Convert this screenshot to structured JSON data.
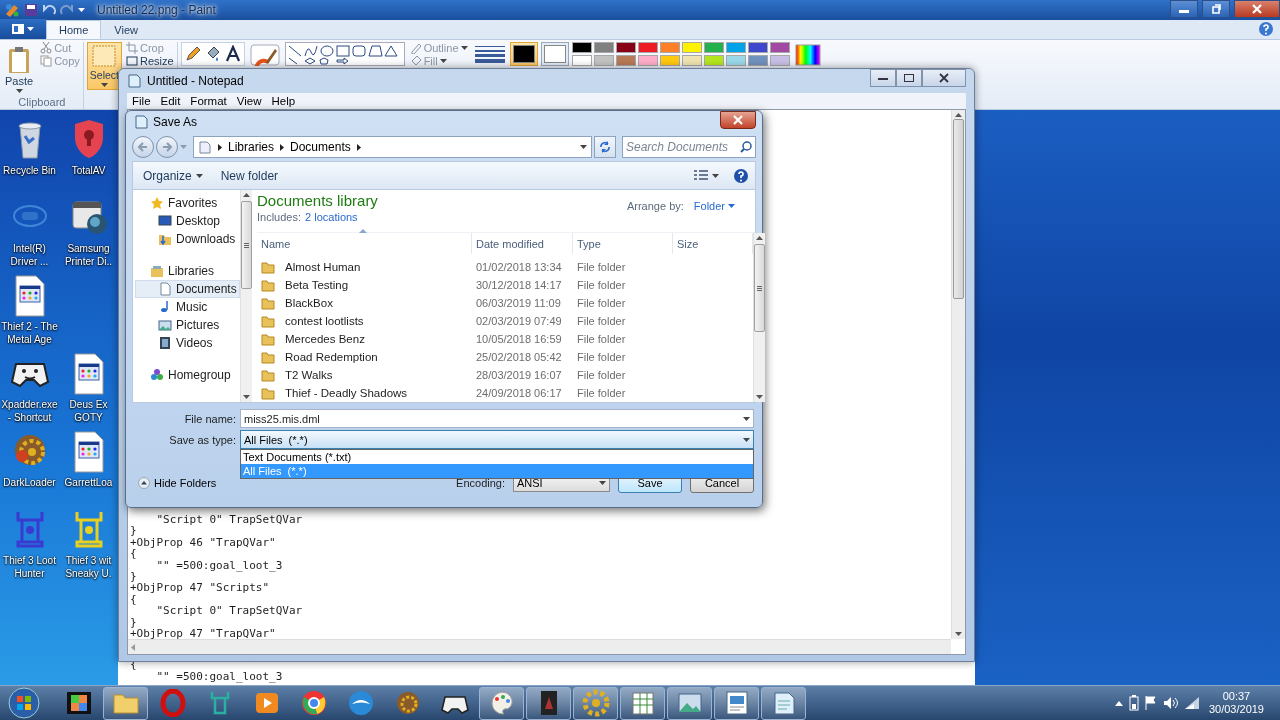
{
  "paint": {
    "title": "Untitled 22.png - Paint",
    "tabs": [
      {
        "label": "Home",
        "selected": true
      },
      {
        "label": "View",
        "selected": false
      }
    ],
    "clipboard": {
      "paste": "Paste",
      "cut": "Cut",
      "copy": "Copy",
      "label": "Clipboard"
    },
    "image": {
      "select": "Select",
      "crop": "Crop",
      "resize": "Resize"
    },
    "shapes": {
      "outline": "Outline",
      "fill": "Fill"
    },
    "color_swatches": [
      {
        "color": "#000000",
        "selected": true
      },
      {
        "color": "#ffffff",
        "selected": false
      }
    ],
    "palette": [
      {
        "color": "#000000"
      },
      {
        "color": "#7f7f7f"
      },
      {
        "color": "#880015"
      },
      {
        "color": "#ed1c24"
      },
      {
        "color": "#ff7f27"
      },
      {
        "color": "#fff200"
      },
      {
        "color": "#22b14c"
      },
      {
        "color": "#00a2e8"
      },
      {
        "color": "#3f48cc"
      },
      {
        "color": "#a349a4"
      },
      {
        "color": "#ffffff"
      },
      {
        "color": "#c3c3c3"
      },
      {
        "color": "#b97a57"
      },
      {
        "color": "#ffaec9"
      },
      {
        "color": "#ffc90e"
      },
      {
        "color": "#efe4b0"
      },
      {
        "color": "#b5e61d"
      },
      {
        "color": "#99d9ea"
      },
      {
        "color": "#7092be"
      },
      {
        "color": "#c8bfe7"
      }
    ]
  },
  "desktop": {
    "rows": [
      [
        {
          "label": "Recycle Bin"
        },
        {
          "label": "TotalAV"
        }
      ],
      [
        {
          "label": "Intel(R) Driver ..."
        },
        {
          "label": "Samsung Printer Di.."
        }
      ],
      [
        {
          "label": "Thief 2 - The Metal Age"
        }
      ],
      [
        {
          "label": "Xpadder.exe - Shortcut"
        },
        {
          "label": "Deus Ex GOTY"
        }
      ],
      [
        {
          "label": "DarkLoader"
        },
        {
          "label": "GarrettLoa"
        }
      ],
      [
        {
          "label": "Thief 3 Loot Hunter"
        },
        {
          "label": "Thief 3 wit Sneaky U."
        }
      ]
    ]
  },
  "image_lines": [
    "{",
    "    \"\" =500:goal_loot_3"
  ],
  "notepad": {
    "title": "Untitled - Notepad",
    "menu": [
      "File",
      "Edit",
      "Format",
      "View",
      "Help"
    ],
    "lines": [
      "    \"Script 0\" TrapSetQVar",
      "}",
      "+ObjProp 46 \"TrapQVar\"",
      "{",
      "    \"\" =500:goal_loot_3",
      "}",
      "+ObjProp 47 \"Scripts\"",
      "{",
      "    \"Script 0\" TrapSetQVar",
      "}",
      "+ObjProp 47 \"TrapQVar\""
    ]
  },
  "save_dialog": {
    "title": "Save As",
    "breadcrumb": [
      "Libraries",
      "Documents"
    ],
    "search": {
      "placeholder": "Search Documents"
    },
    "toolbar": {
      "organize": "Organize",
      "new_folder": "New folder"
    },
    "nav": [
      {
        "label": "Favorites",
        "selected": false,
        "children": [
          {
            "label": "Desktop",
            "selected": false
          },
          {
            "label": "Downloads",
            "selected": false
          }
        ]
      },
      {
        "label": "Libraries",
        "selected": false,
        "children": [
          {
            "label": "Documents",
            "selected": true
          },
          {
            "label": "Music",
            "selected": false
          },
          {
            "label": "Pictures",
            "selected": false
          },
          {
            "label": "Videos",
            "selected": false
          }
        ]
      },
      {
        "label": "Homegroup",
        "selected": false
      }
    ],
    "library": {
      "title": "Documents library",
      "includes_label": "Includes:",
      "includes_link": "2 locations",
      "arrange_label": "Arrange by:",
      "arrange_value": "Folder"
    },
    "columns": [
      "Name",
      "Date modified",
      "Type",
      "Size"
    ],
    "files": [
      {
        "name": "Almost Human",
        "date": "01/02/2018 13:34",
        "type": "File folder"
      },
      {
        "name": "Beta Testing",
        "date": "30/12/2018 14:17",
        "type": "File folder"
      },
      {
        "name": "BlackBox",
        "date": "06/03/2019 11:09",
        "type": "File folder"
      },
      {
        "name": "contest lootlists",
        "date": "02/03/2019 07:49",
        "type": "File folder"
      },
      {
        "name": "Mercedes Benz",
        "date": "10/05/2018 16:59",
        "type": "File folder"
      },
      {
        "name": "Road Redemption",
        "date": "25/02/2018 05:42",
        "type": "File folder"
      },
      {
        "name": "T2 Walks",
        "date": "28/03/2019 16:07",
        "type": "File folder"
      },
      {
        "name": "Thief - Deadly Shadows",
        "date": "24/09/2018 06:17",
        "type": "File folder"
      }
    ],
    "file_name": {
      "label": "File name:",
      "value": "miss25.mis.dml"
    },
    "save_type": {
      "label": "Save as type:",
      "value": "All Files  (*.*)",
      "expanded": true,
      "options": [
        {
          "label": "Text Documents (*.txt)",
          "selected": false
        },
        {
          "label": "All Files  (*.*)",
          "selected": true
        }
      ]
    },
    "hide_folders": "Hide Folders",
    "encoding": {
      "label": "Encoding:",
      "value": "ANSI"
    },
    "buttons": [
      "Save",
      "Cancel"
    ]
  },
  "taskbar": {
    "apps": [
      {
        "running": false
      },
      {
        "running": true
      },
      {
        "running": false
      },
      {
        "running": false
      },
      {
        "running": false
      },
      {
        "running": false
      },
      {
        "running": false
      },
      {
        "running": false
      },
      {
        "running": false
      },
      {
        "running": true
      },
      {
        "running": true
      },
      {
        "running": true
      },
      {
        "running": true
      },
      {
        "running": true
      },
      {
        "running": true
      },
      {
        "running": true
      }
    ],
    "clock": {
      "time": "00:37",
      "date": "30/03/2019"
    }
  }
}
